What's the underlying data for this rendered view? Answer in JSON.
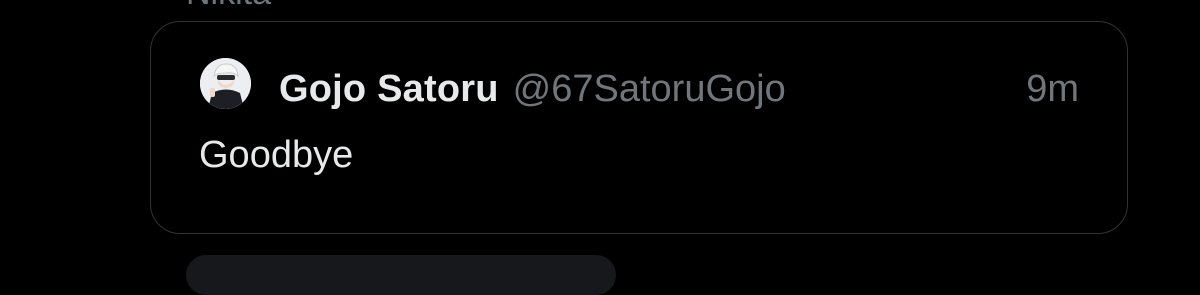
{
  "previous_tweet": {
    "author_name_partial": "Nikita"
  },
  "quoted_tweet": {
    "display_name": "Gojo Satoru",
    "handle": "@67SatoruGojo",
    "time": "9m",
    "text": "Goodbye",
    "avatar_icon": "profile-avatar"
  },
  "colors": {
    "background": "#000000",
    "card_border": "#2f3336",
    "primary_text": "#e7e9ea",
    "secondary_text": "#71767b"
  }
}
